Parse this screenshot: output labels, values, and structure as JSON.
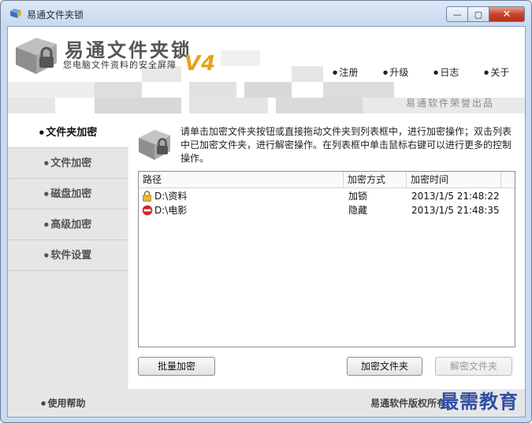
{
  "window": {
    "title": "易通文件夹锁",
    "min_label": "—",
    "max_label": "▢",
    "close_label": "✕"
  },
  "banner": {
    "app_name": "易通文件夹锁",
    "subtitle": "您电脑文件资料的安全屏障",
    "version": "V4",
    "menu": [
      "注册",
      "升级",
      "日志",
      "关于"
    ],
    "brand_note": "易通软件荣誉出品"
  },
  "sidebar": {
    "items": [
      {
        "label": "文件夹加密",
        "active": true
      },
      {
        "label": "文件加密"
      },
      {
        "label": "磁盘加密"
      },
      {
        "label": "高级加密"
      },
      {
        "label": "软件设置"
      }
    ]
  },
  "main": {
    "instructions": "请单击加密文件夹按钮或直接拖动文件夹到列表框中，进行加密操作；双击列表中已加密文件夹，进行解密操作。在列表框中单击鼠标右键可以进行更多的控制操作。",
    "columns": [
      "路径",
      "加密方式",
      "加密时间"
    ],
    "rows": [
      {
        "path": "D:\\资料",
        "method": "加锁",
        "time": "2013/1/5 21:48:22",
        "icon": "lock-icon"
      },
      {
        "path": "D:\\电影",
        "method": "隐藏",
        "time": "2013/1/5 21:48:35",
        "icon": "hidden-icon"
      }
    ],
    "buttons": {
      "batch": "批量加密",
      "encrypt": "加密文件夹",
      "decrypt": "解密文件夹"
    }
  },
  "footer": {
    "help": "使用帮助",
    "copyright": "易通软件版权所有",
    "watermark": "最需教育"
  },
  "colors": {
    "version_accent": "#e8a01a",
    "window_frame": "#c9daf0",
    "watermark": "#2f4fa0"
  }
}
